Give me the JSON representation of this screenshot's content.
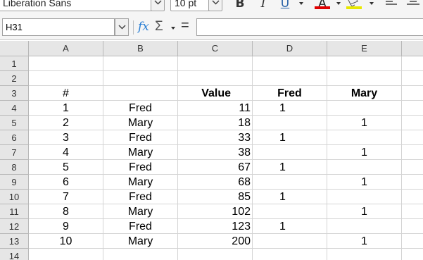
{
  "toolbar": {
    "font_name": "Liberation Sans",
    "font_size": "10 pt",
    "bold_icon": "B",
    "italic_icon": "I",
    "underline_icon": "U",
    "font_color_icon": "A",
    "font_color_swatch": "#e00000",
    "highlight_swatch": "#e8e800"
  },
  "formula_bar": {
    "name_box": "H31",
    "fx_label": "fx",
    "sigma_label": "Σ",
    "equals_label": "=",
    "content": ""
  },
  "columns": [
    "A",
    "B",
    "C",
    "D",
    "E"
  ],
  "rows": [
    "1",
    "2",
    "3",
    "4",
    "5",
    "6",
    "7",
    "8",
    "9",
    "10",
    "11",
    "12",
    "13",
    "14"
  ],
  "cells": {
    "header": {
      "A": "#",
      "B": "",
      "C": "Value",
      "D": "Fred",
      "E": "Mary"
    },
    "data": [
      {
        "A": "1",
        "B": "Fred",
        "C": "11",
        "D": "1",
        "E": ""
      },
      {
        "A": "2",
        "B": "Mary",
        "C": "18",
        "D": "",
        "E": "1"
      },
      {
        "A": "3",
        "B": "Fred",
        "C": "33",
        "D": "1",
        "E": ""
      },
      {
        "A": "4",
        "B": "Mary",
        "C": "38",
        "D": "",
        "E": "1"
      },
      {
        "A": "5",
        "B": "Fred",
        "C": "67",
        "D": "1",
        "E": ""
      },
      {
        "A": "6",
        "B": "Mary",
        "C": "68",
        "D": "",
        "E": "1"
      },
      {
        "A": "7",
        "B": "Fred",
        "C": "85",
        "D": "1",
        "E": ""
      },
      {
        "A": "8",
        "B": "Mary",
        "C": "102",
        "D": "",
        "E": "1"
      },
      {
        "A": "9",
        "B": "Fred",
        "C": "123",
        "D": "1",
        "E": ""
      },
      {
        "A": "10",
        "B": "Mary",
        "C": "200",
        "D": "",
        "E": "1"
      }
    ]
  }
}
